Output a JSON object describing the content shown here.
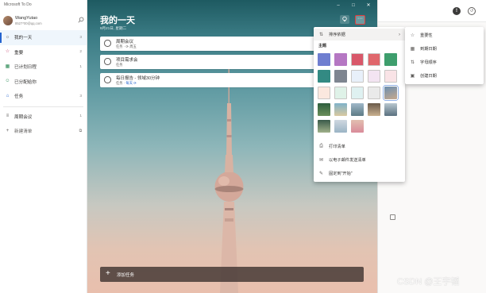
{
  "app": {
    "title": "Microsoft To Do"
  },
  "profile": {
    "name": "WangYutao",
    "email": "8527*00@qq.com"
  },
  "sidebar": {
    "items": [
      {
        "label": "我的一天",
        "count": "3",
        "icon": "sun-icon"
      },
      {
        "label": "重要",
        "count": "2",
        "icon": "star-icon"
      },
      {
        "label": "已计划日程",
        "count": "1",
        "icon": "calendar-icon"
      },
      {
        "label": "已分配给你",
        "count": "",
        "icon": "person-icon"
      },
      {
        "label": "任务",
        "count": "3",
        "icon": "home-icon"
      }
    ],
    "lists": [
      {
        "label": "周期会议",
        "count": "1",
        "icon": "list-icon"
      }
    ],
    "new_list": {
      "label": "新建清单",
      "icon": "plus-icon"
    }
  },
  "main": {
    "list_title": "我的一天",
    "date": "9月21日, 星期二",
    "tasks": [
      {
        "title": "周期会议",
        "meta_prefix": "任务 · ",
        "meta_accent": "",
        "meta_rest": "周五",
        "starred": false
      },
      {
        "title": "项目需求会",
        "meta_prefix": "任务",
        "meta_accent": "",
        "meta_rest": "",
        "starred": false
      },
      {
        "title": "每日报告 - 领域30分钟",
        "meta_prefix": "任务 · ",
        "meta_accent": "每天",
        "meta_rest": "",
        "starred": false
      }
    ],
    "add_task_label": "添加任务"
  },
  "menu": {
    "sort_label": "排序依据",
    "theme_label": "主题",
    "print_label": "打印清单",
    "email_label": "以电子邮件发送清单",
    "pin_label": "固定到\"开始\""
  },
  "submenu": {
    "items": [
      {
        "label": "重要性",
        "icon": "star-icon"
      },
      {
        "label": "到期日期",
        "icon": "calendar-icon"
      },
      {
        "label": "字母顺序",
        "icon": "sort-icon"
      },
      {
        "label": "创建日期",
        "icon": "calendar-add-icon"
      }
    ]
  },
  "theme_colors": [
    "#6f7ed0",
    "#b577c3",
    "#d9586a",
    "#e0676c",
    "#3e9e6d",
    "#338a83",
    "#7e8590",
    "#e8f0fa",
    "#f3e4f2",
    "#f9e3e6",
    "#fbe8df",
    "#dff2e8",
    "#dff1f1",
    "#eaeaea"
  ],
  "watermark": "CSDN @王宇韬"
}
